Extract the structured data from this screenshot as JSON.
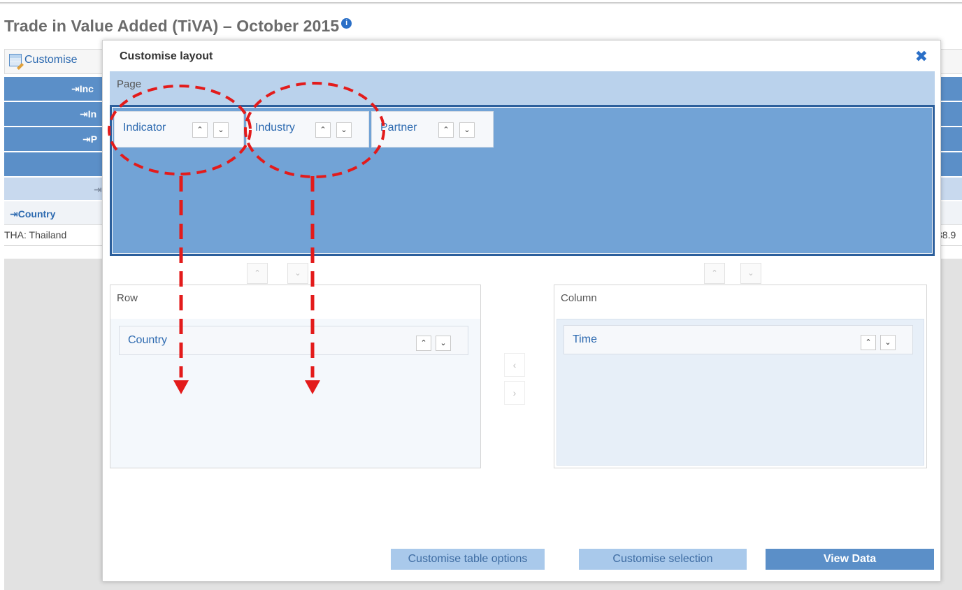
{
  "page": {
    "title": "Trade in Value Added (TiVA) – October 2015",
    "info_icon": "info-icon"
  },
  "toolbar": {
    "customise_label": "Customise",
    "customise_icon": "table-edit-icon"
  },
  "background_table": {
    "row_headers": [
      "Inc",
      "In",
      "P"
    ],
    "country_header": "Country",
    "row_value_label": "THA: Thailand",
    "row_value_tail": "38.9"
  },
  "modal": {
    "title": "Customise layout",
    "close_icon": "close-icon",
    "page_zone": {
      "label": "Page",
      "chips": [
        {
          "label": "Indicator"
        },
        {
          "label": "Industry"
        },
        {
          "label": "Partner"
        }
      ]
    },
    "row_zone": {
      "label": "Row",
      "chips": [
        {
          "label": "Country"
        }
      ]
    },
    "column_zone": {
      "label": "Column",
      "chips": [
        {
          "label": "Time"
        }
      ]
    },
    "buttons": {
      "table_options": "Customise table options",
      "selection": "Customise selection",
      "view_data": "View Data"
    }
  },
  "colors": {
    "accent_blue": "#5b8fc8",
    "page_drop_blue": "#72a3d6",
    "annotation_red": "#e31b1b"
  }
}
